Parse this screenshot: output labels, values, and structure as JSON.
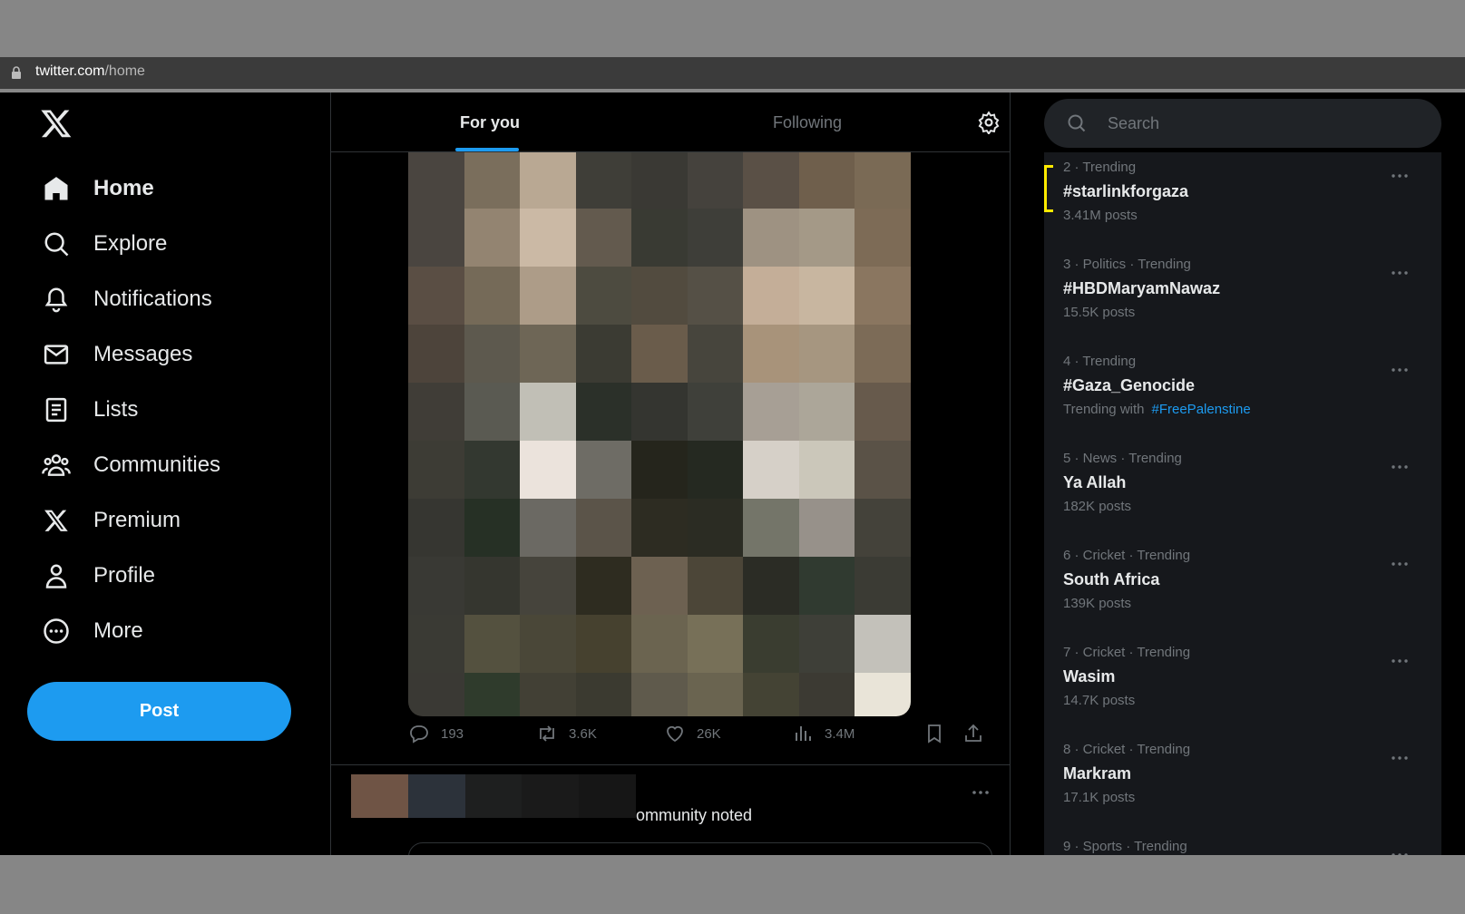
{
  "browser": {
    "url_host": "twitter.com",
    "url_path": "/home"
  },
  "sidebar": {
    "items": [
      {
        "label": "Home",
        "icon": "home-icon",
        "active": true
      },
      {
        "label": "Explore",
        "icon": "search-icon"
      },
      {
        "label": "Notifications",
        "icon": "bell-icon"
      },
      {
        "label": "Messages",
        "icon": "envelope-icon"
      },
      {
        "label": "Lists",
        "icon": "list-icon"
      },
      {
        "label": "Communities",
        "icon": "people-icon"
      },
      {
        "label": "Premium",
        "icon": "x-logo-icon"
      },
      {
        "label": "Profile",
        "icon": "person-icon"
      },
      {
        "label": "More",
        "icon": "more-circle-icon"
      }
    ],
    "post_label": "Post"
  },
  "main": {
    "tabs": [
      {
        "label": "For you",
        "active": true
      },
      {
        "label": "Following"
      }
    ],
    "tweet1_actions": {
      "replies": "193",
      "reposts": "3.6K",
      "likes": "26K",
      "views": "3.4M"
    },
    "tweet2": {
      "text": "ommunity noted"
    }
  },
  "search": {
    "placeholder": "Search"
  },
  "trends": [
    {
      "meta": "2 · Trending",
      "title": "#starlinkforgaza",
      "sub": "3.41M posts"
    },
    {
      "meta": "3 · Politics · Trending",
      "title": "#HBDMaryamNawaz",
      "sub": "15.5K posts"
    },
    {
      "meta": "4 · Trending",
      "title": "#Gaza_Genocide",
      "sub": "Trending with",
      "link": "#FreePalenstine"
    },
    {
      "meta": "5 · News · Trending",
      "title": "Ya Allah",
      "sub": "182K posts"
    },
    {
      "meta": "6 · Cricket · Trending",
      "title": "South Africa",
      "sub": "139K posts"
    },
    {
      "meta": "7 · Cricket · Trending",
      "title": "Wasim",
      "sub": "14.7K posts"
    },
    {
      "meta": "8 · Cricket · Trending",
      "title": "Markram",
      "sub": "17.1K posts"
    },
    {
      "meta": "9 · Sports · Trending",
      "title": "",
      "sub": ""
    }
  ],
  "colors": {
    "accent": "#1d9bf0",
    "highlight": "#ffea00"
  }
}
